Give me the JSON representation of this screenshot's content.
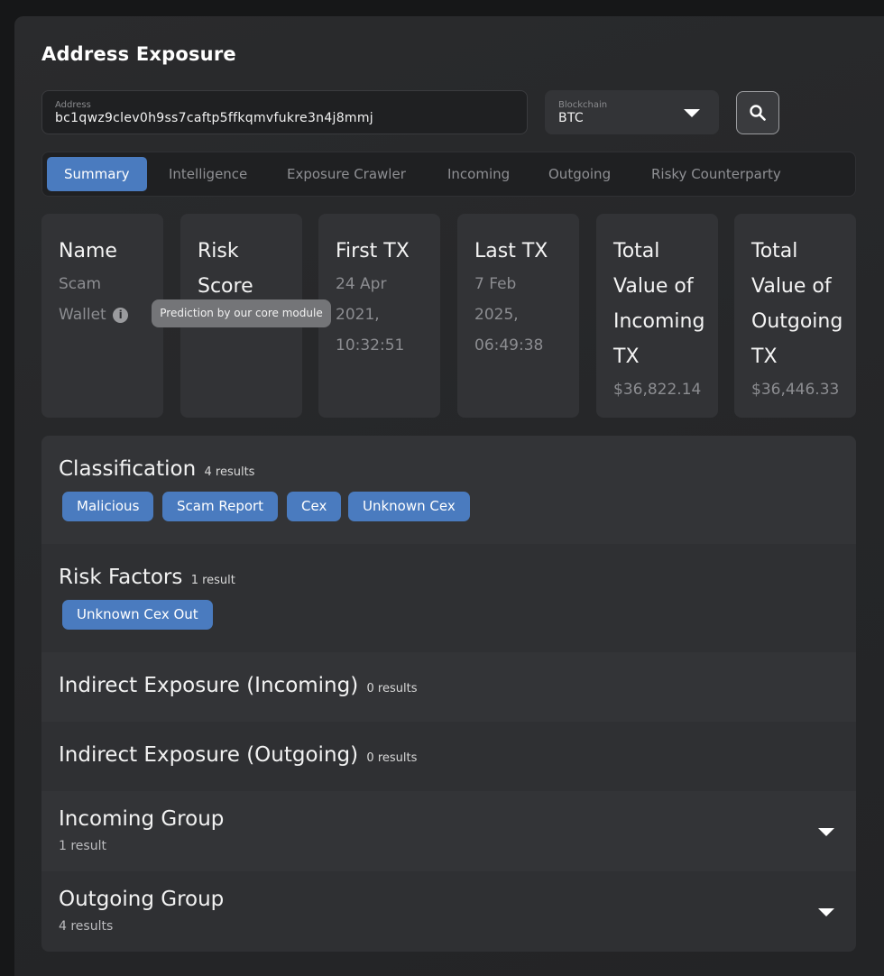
{
  "page": {
    "title": "Address Exposure"
  },
  "address_field": {
    "label": "Address",
    "value": "bc1qwz9clev0h9ss7caftp5ffkqmvfukre3n4j8mmj"
  },
  "blockchain_field": {
    "label": "Blockchain",
    "value": "BTC"
  },
  "search": {
    "icon": "search-icon"
  },
  "tabs": [
    {
      "label": "Summary",
      "active": true
    },
    {
      "label": "Intelligence",
      "active": false
    },
    {
      "label": "Exposure Crawler",
      "active": false
    },
    {
      "label": "Incoming",
      "active": false
    },
    {
      "label": "Outgoing",
      "active": false
    },
    {
      "label": "Risky Counterparty",
      "active": false
    }
  ],
  "cards": {
    "name": {
      "h1": "Name",
      "s1": "Scam",
      "s2": "Wallet",
      "info_icon": "i"
    },
    "risk": {
      "h1": "Risk",
      "h2": "Score"
    },
    "first_tx": {
      "h1": "First TX",
      "s1": "24 Apr",
      "s2": "2021,",
      "s3": "10:32:51"
    },
    "last_tx": {
      "h1": "Last TX",
      "s1": "7 Feb",
      "s2": "2025,",
      "s3": "06:49:38"
    },
    "total_in": {
      "h1": "Total",
      "h2": "Value of",
      "h3": "Incoming",
      "h4": "TX",
      "s1": "$36,822.14"
    },
    "total_out": {
      "h1": "Total",
      "h2": "Value of",
      "h3": "Outgoing",
      "h4": "TX",
      "s1": "$36,446.33"
    }
  },
  "tooltip": {
    "text": "Prediction by our core module"
  },
  "sections": {
    "classification": {
      "title": "Classification",
      "count": "4 results",
      "tags": [
        "Malicious",
        "Scam Report",
        "Cex",
        "Unknown Cex"
      ]
    },
    "risk_factors": {
      "title": "Risk Factors",
      "count": "1 result",
      "tags": [
        "Unknown Cex Out"
      ]
    },
    "indirect_in": {
      "title": "Indirect Exposure (Incoming)",
      "count": "0 results"
    },
    "indirect_out": {
      "title": "Indirect Exposure (Outgoing)",
      "count": "0 results"
    },
    "incoming_group": {
      "title": "Incoming Group",
      "sub": "1 result"
    },
    "outgoing_group": {
      "title": "Outgoing Group",
      "sub": "4 results"
    }
  },
  "colors": {
    "accent": "#4a7bbf",
    "panel": "#2a2b2d",
    "card": "#323336"
  }
}
